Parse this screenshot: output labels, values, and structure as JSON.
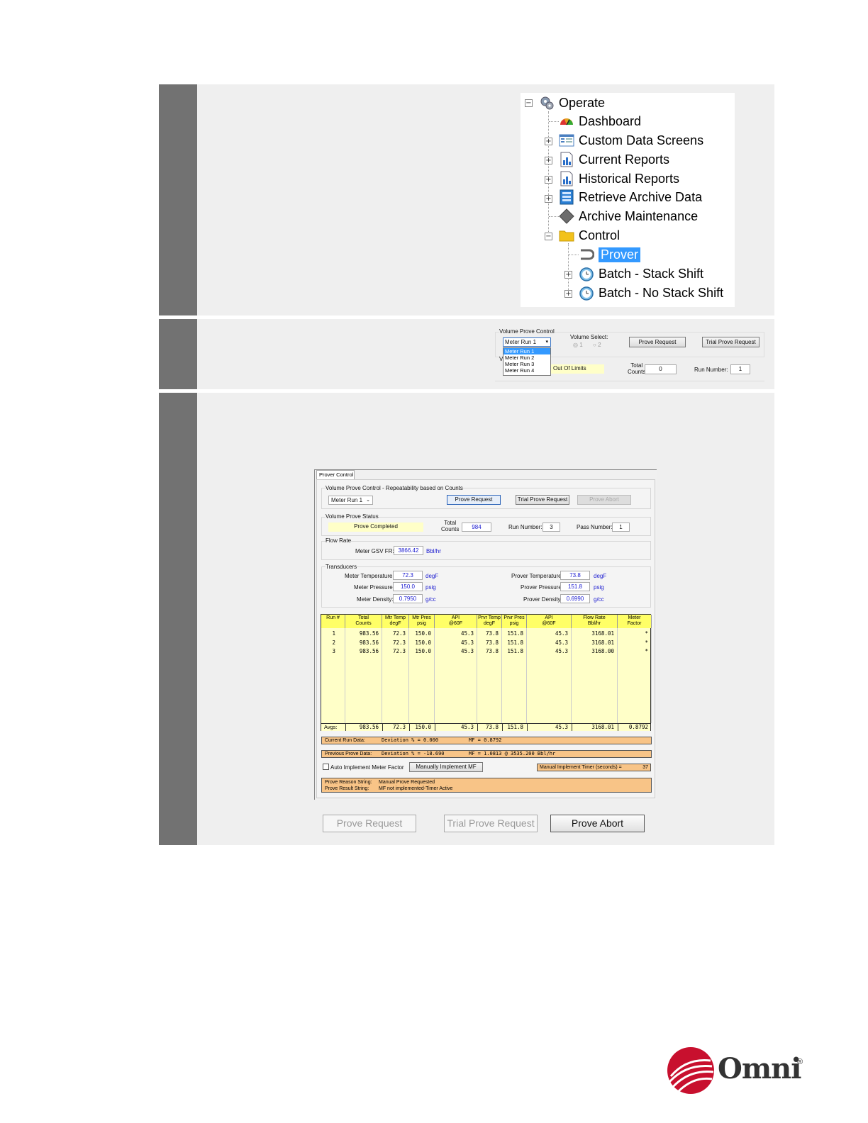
{
  "tree": {
    "items": [
      {
        "label": "Operate",
        "icon": "gears-icon"
      },
      {
        "label": "Dashboard",
        "icon": "gauge-icon"
      },
      {
        "label": "Custom Data Screens",
        "icon": "screen-list-icon"
      },
      {
        "label": "Current Reports",
        "icon": "report-chart-icon"
      },
      {
        "label": "Historical Reports",
        "icon": "report-chart-icon"
      },
      {
        "label": "Retrieve Archive Data",
        "icon": "archive-icon"
      },
      {
        "label": "Archive Maintenance",
        "icon": "diamond-icon"
      },
      {
        "label": "Control",
        "icon": "folder-icon"
      },
      {
        "label": "Prover",
        "icon": "prover-loop-icon"
      },
      {
        "label": "Batch - Stack Shift",
        "icon": "clock-icon"
      },
      {
        "label": "Batch - No Stack Shift",
        "icon": "clock-icon"
      }
    ],
    "expand_symbol": "+",
    "collapse_symbol": "−"
  },
  "dropdown_panel": {
    "group_title": "Volume Prove Control",
    "selected": "Meter Run 1",
    "options": [
      "Meter Run 1",
      "Meter Run 2",
      "Meter Run 3",
      "Meter Run 4"
    ],
    "volume_select_label": "Volume Select:",
    "radio1": "1",
    "radio2": "2",
    "prove_request": "Prove Request",
    "trial_prove_request": "Trial Prove Request",
    "status_prefix": "V",
    "status_value": "Out Of Limits",
    "total_counts_label_1": "Total",
    "total_counts_label_2": "Counts",
    "total_counts": "0",
    "run_number_label": "Run Number:",
    "run_number": "1"
  },
  "prover": {
    "tab": "Prover Control",
    "control_group": "Volume Prove Control - Repeatability based on Counts",
    "meter_run": "Meter Run 1",
    "prove_request": "Prove Request",
    "trial_prove_request": "Trial Prove Request",
    "prove_abort": "Prove Abort",
    "status_group": "Volume Prove Status",
    "status_value": "Prove Completed",
    "total_counts_label_1": "Total",
    "total_counts_label_2": "Counts",
    "total_counts": "984",
    "run_number_label": "Run Number:",
    "run_number": "3",
    "pass_number_label": "Pass Number:",
    "pass_number": "1",
    "flow_group": "Flow Rate",
    "gsv_label": "Meter GSV FR:",
    "gsv_value": "3866.42",
    "gsv_unit": "Bbl/hr",
    "transducers_group": "Transducers",
    "meter_temp_label": "Meter Temperature:",
    "meter_temp": "72.3",
    "meter_temp_unit": "degF",
    "meter_pres_label": "Meter Pressure:",
    "meter_pres": "150.0",
    "meter_pres_unit": "psig",
    "meter_dens_label": "Meter Density:",
    "meter_dens": "0.7950",
    "meter_dens_unit": "g/cc",
    "prover_temp_label": "Prover Temperature:",
    "prover_temp": "73.8",
    "prover_temp_unit": "degF",
    "prover_pres_label": "Prover Pressure:",
    "prover_pres": "151.8",
    "prover_pres_unit": "psig",
    "prover_dens_label": "Prover Density:",
    "prover_dens": "0.6990",
    "prover_dens_unit": "g/cc",
    "table": {
      "headers": [
        [
          "Run #",
          ""
        ],
        [
          "Total",
          "Counts"
        ],
        [
          "Mtr Temp",
          "degF"
        ],
        [
          "Mtr Pres",
          "psig"
        ],
        [
          "API",
          "@60F"
        ],
        [
          "Prvr Temp",
          "degF"
        ],
        [
          "Prvr Pres",
          "psig"
        ],
        [
          "API",
          "@60F"
        ],
        [
          "Flow Rate",
          "Bbl/hr"
        ],
        [
          "Meter",
          "Factor"
        ]
      ],
      "rows": [
        [
          "1",
          "983.56",
          "72.3",
          "150.0",
          "45.3",
          "73.8",
          "151.8",
          "45.3",
          "3168.01",
          "*"
        ],
        [
          "2",
          "983.56",
          "72.3",
          "150.0",
          "45.3",
          "73.8",
          "151.8",
          "45.3",
          "3168.01",
          "*"
        ],
        [
          "3",
          "983.56",
          "72.3",
          "150.0",
          "45.3",
          "73.8",
          "151.8",
          "45.3",
          "3168.00",
          "*"
        ]
      ],
      "avgs_label": "Avgs:",
      "avgs": [
        "983.56",
        "72.3",
        "150.0",
        "45.3",
        "73.8",
        "151.8",
        "45.3",
        "3168.01",
        "0.8792"
      ]
    },
    "current_run_label": "Current Run Data:",
    "current_run_dev": "Deviation % = 0.000",
    "current_run_mf": "MF = 0.8792",
    "previous_prove_label": "Previous Prove Data:",
    "previous_prove_dev": "Deviation % = -18.690",
    "previous_prove_mf": "MF = 1.0813 @ 3535.200 Bbl/hr",
    "auto_implement": "Auto Implement Meter Factor",
    "manually_implement": "Manually Implement MF",
    "timer_label": "Manual Implement Timer (seconds) =",
    "timer_value": "37",
    "reason_label": "Prove Reason String:",
    "reason_value": "Manual Prove Requested",
    "result_label": "Prove Result String:",
    "result_value": "MF not implemented-Timer Active"
  },
  "bottom_buttons": {
    "prove_request": "Prove Request",
    "trial_prove_request": "Trial Prove Request",
    "prove_abort": "Prove Abort"
  },
  "logo": {
    "text": "Omni",
    "mark": "®",
    "color": "#c8102e"
  }
}
